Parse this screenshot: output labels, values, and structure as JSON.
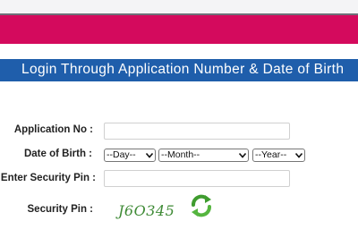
{
  "header": {
    "brand_color": "#d40a5d",
    "title_bar_color": "#1f5eab"
  },
  "form": {
    "title": "Login Through Application Number & Date of Birth",
    "application_no": {
      "label": "Application No :",
      "value": "",
      "placeholder": ""
    },
    "date_of_birth": {
      "label": "Date of Birth :",
      "day": "--Day--",
      "month": "--Month--",
      "year": "--Year--"
    },
    "enter_security_pin": {
      "label": "Enter Security Pin :",
      "value": "",
      "placeholder": ""
    },
    "security_pin": {
      "label": "Security Pin :",
      "captcha_text": "J6O345",
      "captcha_color": "#3e8a35",
      "refresh_icon": "refresh-icon"
    }
  }
}
